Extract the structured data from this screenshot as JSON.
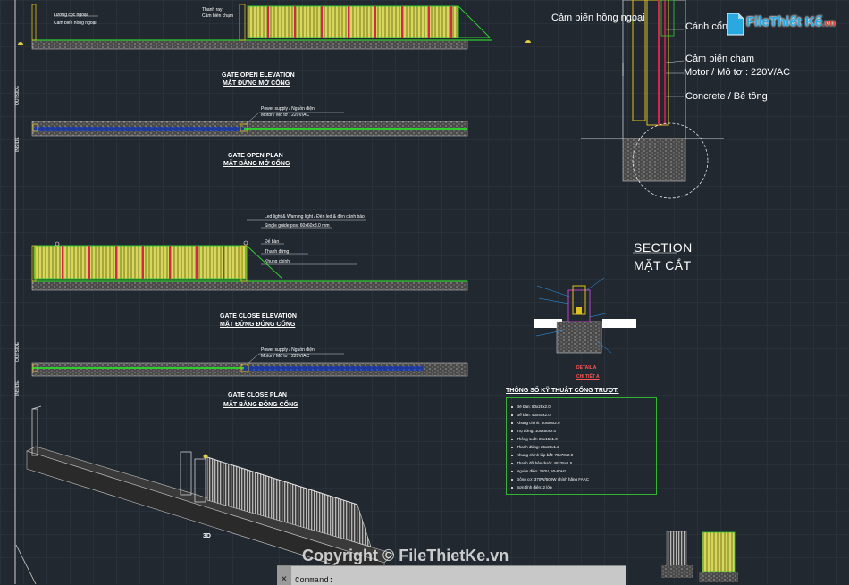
{
  "drawing": {
    "elev_open_note1": "Lưỡng cọc ngoại",
    "elev_open_note2": "Cảm biến hồng ngoại",
    "elev_open_note3": "Thanh ray",
    "elev_open_note4": "Cảm biến chạm",
    "title_open_elev_en": "GATE OPEN ELEVATION",
    "title_open_elev_vi": "MẶT ĐỨNG MỞ CỔNG",
    "title_open_plan_en": "GATE OPEN PLAN",
    "title_open_plan_vi": "MẶT BẰNG MỞ CỔNG",
    "title_close_elev_en": "GATE CLOSE ELEVATION",
    "title_close_elev_vi": "MẶT ĐỨNG ĐÓNG CỔNG",
    "title_close_plan_en": "GATE CLOSE PLAN",
    "title_close_plan_vi": "MẶT BẰNG ĐÓNG CỔNG",
    "plan_note1": "Power supply / Nguồn điện",
    "plan_note2": "Motor / Mô tơ : 220V/AC",
    "close_note1": "Led light & Warning light / Đèn led & đèn cảnh báo",
    "close_note2": "Single guide post 60x60x3.0 mm",
    "close_note3": "Đế bàn",
    "close_note4": "Thanh đứng",
    "close_note5": "Khung chính",
    "side_label1": "OUTSIDE",
    "side_label2": "INSIDE",
    "view_3d": "3D",
    "section_en": "SECTION",
    "section_vi": "MẶT CẮT",
    "detail_en": "DETAIL A",
    "detail_vi": "CHI TIẾT A",
    "detail_right_labels": [
      "Cảm biến hồng ngoại",
      "Cánh cổng",
      "Cảm biến chạm",
      "Motor / Mô tơ : 220V/AC",
      "Concrete / Bê tông"
    ]
  },
  "spec": {
    "title": "THÔNG SỐ KỸ THUẬT CỔNG TRƯỢT:",
    "items": [
      "Đế bàn: 80x25x2.0",
      "Đế bàn: 40x40x2.0",
      "Khung chính: 50x50x2.0",
      "Trụ đứng: 100x50x2.0",
      "Thông suốt: 25x15x1.0",
      "Thanh đứng: 25x25x1.2",
      "Khung chính lắp bắt: 70x70x2.0",
      "Thanh đỡ bên dưới: 45x25x1.5",
      "Nguồn điện: 220V, 50-60Hz",
      "Động cơ: 370W/500W chính hãng FAAC",
      "Sơn tĩnh điện: 2 lớp"
    ]
  },
  "command": {
    "close": "✕",
    "text": "Command:"
  },
  "watermark": {
    "logo_main": "FileThiết Kế",
    "logo_suffix": ".vn",
    "copyright": "Copyright © FileThietKe.vn"
  },
  "colors": {
    "background": "#212830",
    "grid": "#2c3540",
    "gate_yellow": "#c8c850",
    "gate_red": "#d22850",
    "line_green": "#2fcc2f",
    "base_gray": "#9a9a9a"
  }
}
